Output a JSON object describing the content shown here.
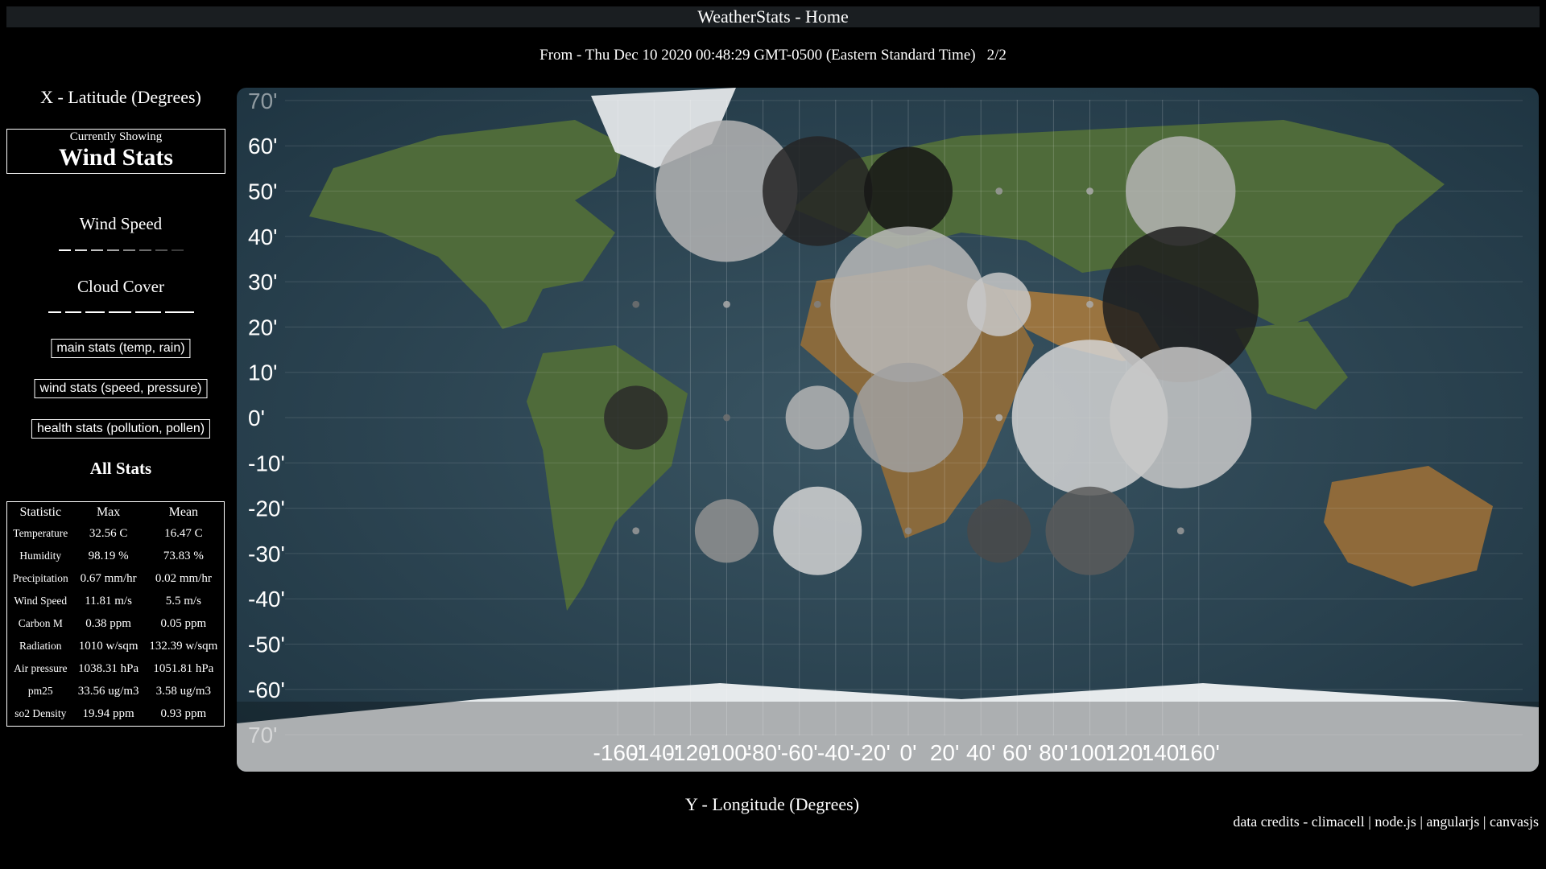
{
  "app": {
    "title": "WeatherStats - Home"
  },
  "header": {
    "from_text": "From - Thu Dec 10 2020 00:48:29 GMT-0500 (Eastern Standard Time)",
    "page": "2/2"
  },
  "sidebar": {
    "x_axis_label": "X - Latitude (Degrees)",
    "currently_showing_label": "Currently Showing",
    "currently_showing_value": "Wind Stats",
    "legends": [
      {
        "title": "Wind Speed",
        "swatches": [
          "#ffffff",
          "#e0e0e0",
          "#c2c2c2",
          "#a4a4a4",
          "#888888",
          "#6c6c6c",
          "#525252",
          "#3a3a3a"
        ]
      },
      {
        "title": "Cloud Cover",
        "swatches": [
          "#ffffff",
          "#ffffff",
          "#ffffff",
          "#ffffff",
          "#ffffff",
          "#ffffff"
        ]
      }
    ],
    "buttons": {
      "main": "main stats (temp, rain)",
      "wind": "wind stats (speed, pressure)",
      "health": "health stats (pollution, pollen)"
    },
    "all_stats_title": "All Stats",
    "table": {
      "headers": [
        "Statistic",
        "Max",
        "Mean"
      ],
      "rows": [
        [
          "Temperature",
          "32.56 C",
          "16.47 C"
        ],
        [
          "Humidity",
          "98.19 %",
          "73.83 %"
        ],
        [
          "Precipitation",
          "0.67 mm/hr",
          "0.02 mm/hr"
        ],
        [
          "Wind Speed",
          "11.81 m/s",
          "5.5 m/s"
        ],
        [
          "Carbon M",
          "0.38 ppm",
          "0.05 ppm"
        ],
        [
          "Radiation",
          "1010 w/sqm",
          "132.39 w/sqm"
        ],
        [
          "Air pressure",
          "1038.31 hPa",
          "1051.81 hPa"
        ],
        [
          "pm25",
          "33.56 ug/m3",
          "3.58 ug/m3"
        ],
        [
          "so2 Density",
          "19.94 ppm",
          "0.93 ppm"
        ]
      ]
    }
  },
  "chart_data": {
    "type": "scatter",
    "background": "world-map",
    "x_ticks": [
      "-160'",
      "-140'",
      "-120'",
      "-100'",
      "-80'",
      "-60'",
      "-40'",
      "-20'",
      "0'",
      "20'",
      "40'",
      "60'",
      "80'",
      "100'",
      "120'",
      "140'",
      "160'"
    ],
    "y_ticks": [
      "70'",
      "60'",
      "50'",
      "40'",
      "30'",
      "20'",
      "10'",
      "0'",
      "-10'",
      "-20'",
      "-30'",
      "-40'",
      "-50'",
      "-60'",
      "70'"
    ],
    "xlim": [
      -180,
      180
    ],
    "ylim": [
      -75,
      75
    ],
    "grid": true,
    "points": [
      {
        "lon": -100,
        "lat": 50,
        "radius": 40,
        "color": "#b4b4b4"
      },
      {
        "lon": -50,
        "lat": 50,
        "radius": 31,
        "color": "#242424"
      },
      {
        "lon": 0,
        "lat": 50,
        "radius": 25,
        "color": "#161616"
      },
      {
        "lon": 50,
        "lat": 50,
        "radius": 2,
        "color": "#9a9a9a"
      },
      {
        "lon": 100,
        "lat": 50,
        "radius": 2,
        "color": "#aaaaaa"
      },
      {
        "lon": 150,
        "lat": 50,
        "radius": 31,
        "color": "#b4b4b4"
      },
      {
        "lon": -150,
        "lat": 25,
        "radius": 2,
        "color": "#707070"
      },
      {
        "lon": -100,
        "lat": 25,
        "radius": 2,
        "color": "#aaaaaa"
      },
      {
        "lon": -50,
        "lat": 25,
        "radius": 2,
        "color": "#808080"
      },
      {
        "lon": 0,
        "lat": 25,
        "radius": 44,
        "color": "#b8b8b8"
      },
      {
        "lon": 50,
        "lat": 25,
        "radius": 18,
        "color": "#c8c8c8"
      },
      {
        "lon": 100,
        "lat": 25,
        "radius": 2,
        "color": "#aaaaaa"
      },
      {
        "lon": 150,
        "lat": 25,
        "radius": 44,
        "color": "#1e1e1e"
      },
      {
        "lon": -150,
        "lat": 0,
        "radius": 18,
        "color": "#2a2a2a"
      },
      {
        "lon": -100,
        "lat": 0,
        "radius": 2,
        "color": "#707070"
      },
      {
        "lon": -50,
        "lat": 0,
        "radius": 18,
        "color": "#b4b4b4"
      },
      {
        "lon": 0,
        "lat": 0,
        "radius": 31,
        "color": "#a0a0a0"
      },
      {
        "lon": 50,
        "lat": 0,
        "radius": 2,
        "color": "#b0b0b0"
      },
      {
        "lon": 100,
        "lat": 0,
        "radius": 44,
        "color": "#d4d4d4"
      },
      {
        "lon": 150,
        "lat": 0,
        "radius": 40,
        "color": "#c8c8c8"
      },
      {
        "lon": -150,
        "lat": -25,
        "radius": 2,
        "color": "#9a9a9a"
      },
      {
        "lon": -100,
        "lat": -25,
        "radius": 18,
        "color": "#909090"
      },
      {
        "lon": -50,
        "lat": -25,
        "radius": 25,
        "color": "#d2d2d2"
      },
      {
        "lon": 0,
        "lat": -25,
        "radius": 2,
        "color": "#8a8a8a"
      },
      {
        "lon": 50,
        "lat": -25,
        "radius": 18,
        "color": "#4a4a4a"
      },
      {
        "lon": 100,
        "lat": -25,
        "radius": 25,
        "color": "#5a5a5a"
      },
      {
        "lon": 150,
        "lat": -25,
        "radius": 2,
        "color": "#9a9a9a"
      }
    ]
  },
  "footer": {
    "y_axis_label": "Y - Longitude (Degrees)",
    "credits": "data credits - climacell | node.js | angularjs | canvasjs"
  }
}
